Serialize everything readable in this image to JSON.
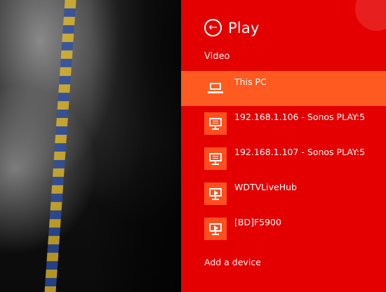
{
  "flyout": {
    "title": "Play",
    "section_label": "Video",
    "add_device_label": "Add a device",
    "accent": "#e40000",
    "selected_bg": "#ff5a1f",
    "tile_bg": "#ff4f1f"
  },
  "devices": [
    {
      "label": "This PC",
      "icon": "laptop-icon",
      "selected": true
    },
    {
      "label": "192.168.1.106 - Sonos PLAY:5",
      "icon": "monitor-list-icon",
      "selected": false
    },
    {
      "label": "192.168.1.107 - Sonos PLAY:5",
      "icon": "monitor-list-icon",
      "selected": false
    },
    {
      "label": "WDTVLiveHub",
      "icon": "monitor-play-icon",
      "selected": false
    },
    {
      "label": "[BD]F5900",
      "icon": "monitor-play-icon",
      "selected": false
    }
  ],
  "icons": {
    "back": "←"
  }
}
